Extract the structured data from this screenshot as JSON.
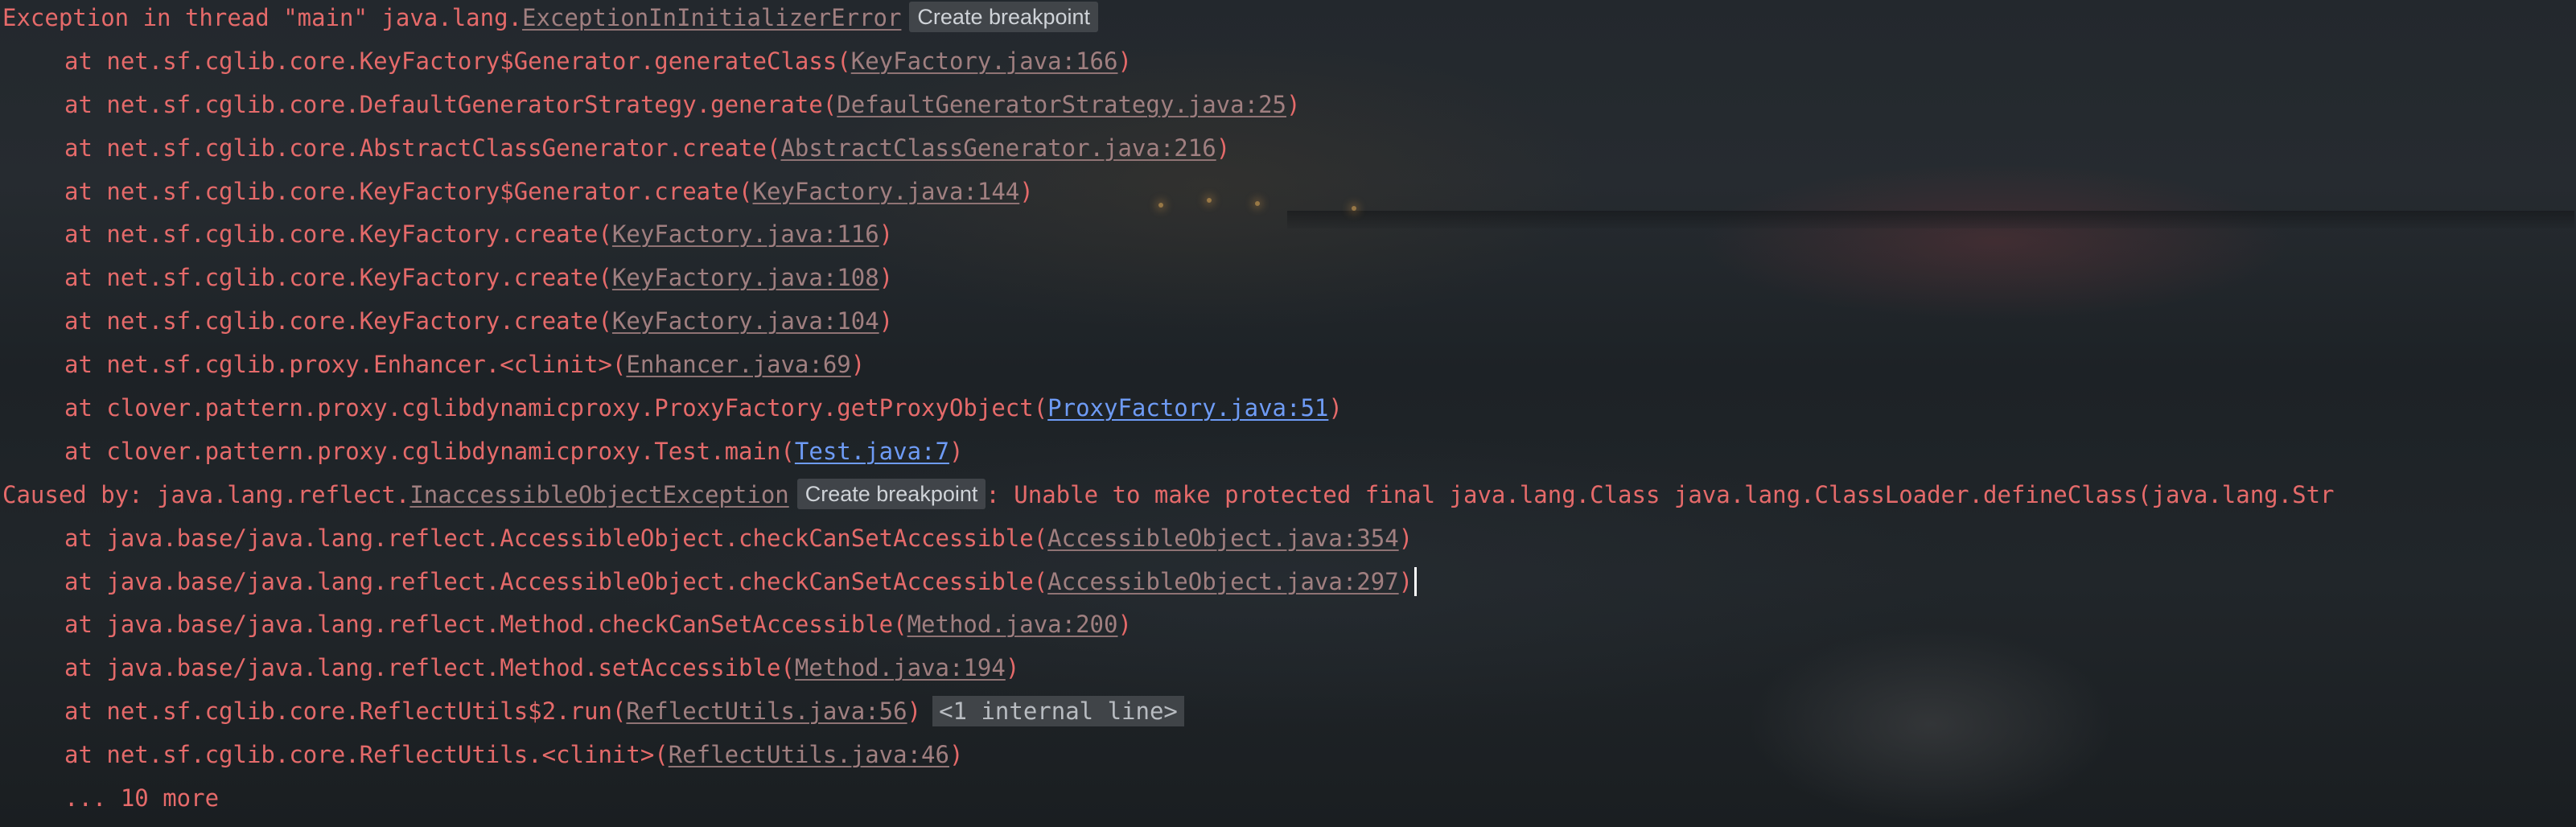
{
  "console": {
    "exception_prefix": "Exception in thread \"main\" java.lang.",
    "exception_class": "ExceptionInInitializerError",
    "create_breakpoint_label": "Create breakpoint",
    "frames1": [
      {
        "at": "at net.sf.cglib.core.KeyFactory$Generator.generateClass(",
        "loc": "KeyFactory.java:166",
        "close": ")"
      },
      {
        "at": "at net.sf.cglib.core.DefaultGeneratorStrategy.generate(",
        "loc": "DefaultGeneratorStrategy.java:25",
        "close": ")"
      },
      {
        "at": "at net.sf.cglib.core.AbstractClassGenerator.create(",
        "loc": "AbstractClassGenerator.java:216",
        "close": ")"
      },
      {
        "at": "at net.sf.cglib.core.KeyFactory$Generator.create(",
        "loc": "KeyFactory.java:144",
        "close": ")"
      },
      {
        "at": "at net.sf.cglib.core.KeyFactory.create(",
        "loc": "KeyFactory.java:116",
        "close": ")"
      },
      {
        "at": "at net.sf.cglib.core.KeyFactory.create(",
        "loc": "KeyFactory.java:108",
        "close": ")"
      },
      {
        "at": "at net.sf.cglib.core.KeyFactory.create(",
        "loc": "KeyFactory.java:104",
        "close": ")"
      },
      {
        "at": "at net.sf.cglib.proxy.Enhancer.<clinit>(",
        "loc": "Enhancer.java:69",
        "close": ")"
      },
      {
        "at": "at clover.pattern.proxy.cglibdynamicproxy.ProxyFactory.getProxyObject(",
        "loc": "ProxyFactory.java:51",
        "close": ")"
      },
      {
        "at": "at clover.pattern.proxy.cglibdynamicproxy.Test.main(",
        "loc": "Test.java:7",
        "close": ")"
      }
    ],
    "caused_prefix": "Caused by: java.lang.reflect.",
    "caused_class": "InaccessibleObjectException",
    "caused_message": ": Unable to make protected final java.lang.Class java.lang.ClassLoader.defineClass(java.lang.Str",
    "frames2": [
      {
        "at": "at java.base/java.lang.reflect.AccessibleObject.checkCanSetAccessible(",
        "loc": "AccessibleObject.java:354",
        "close": ")"
      },
      {
        "at": "at java.base/java.lang.reflect.AccessibleObject.checkCanSetAccessible(",
        "loc": "AccessibleObject.java:297",
        "close": ")"
      },
      {
        "at": "at java.base/java.lang.reflect.Method.checkCanSetAccessible(",
        "loc": "Method.java:200",
        "close": ")"
      },
      {
        "at": "at java.base/java.lang.reflect.Method.setAccessible(",
        "loc": "Method.java:194",
        "close": ")"
      },
      {
        "at": "at net.sf.cglib.core.ReflectUtils$2.run(",
        "loc": "ReflectUtils.java:56",
        "close": ")",
        "folded": "<1 internal line>"
      },
      {
        "at": "at net.sf.cglib.core.ReflectUtils.<clinit>(",
        "loc": "ReflectUtils.java:46",
        "close": ")"
      }
    ],
    "more": "... 10 more"
  },
  "colors": {
    "error_text": "#e56a6a",
    "library_link": "#a07f80",
    "user_link": "#6e9bf5"
  }
}
